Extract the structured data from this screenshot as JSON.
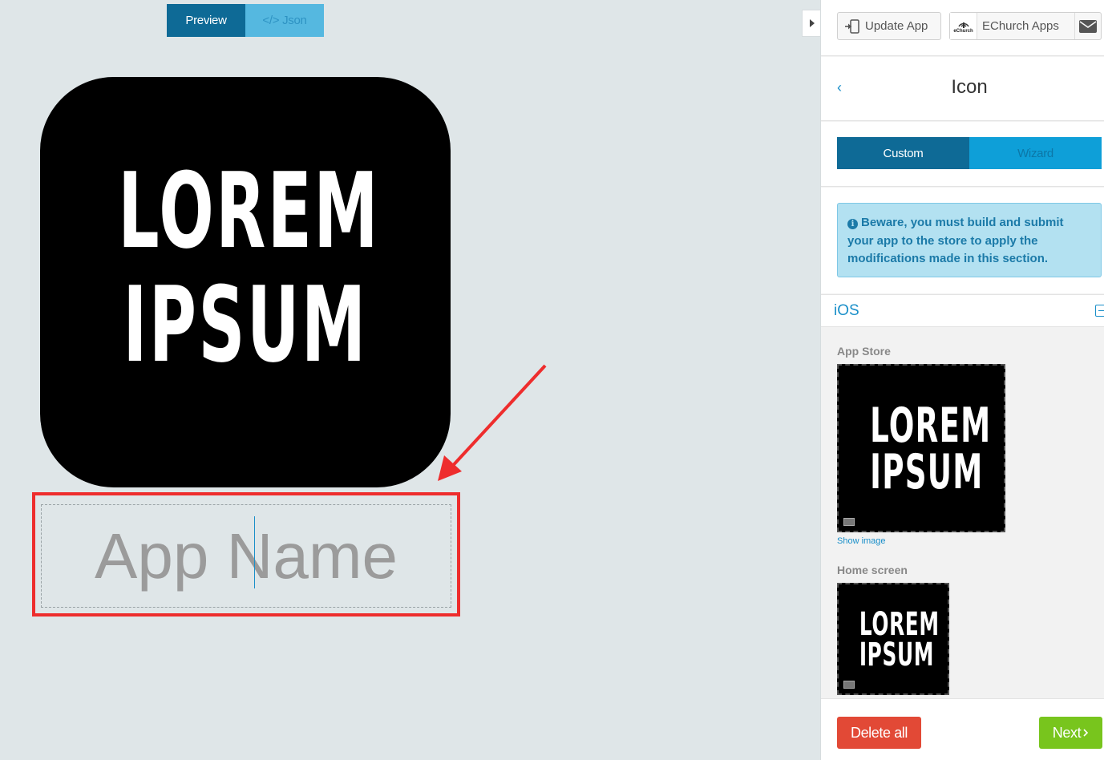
{
  "preview": {
    "tabs": [
      {
        "label": "Preview",
        "active": true
      },
      {
        "label": "</> Json",
        "active": false
      }
    ],
    "icon_text": {
      "line1": "LOREM",
      "line2": "IPSUM"
    },
    "app_name_placeholder": "App Name"
  },
  "panel": {
    "toolbar": {
      "update_label": "Update App",
      "app_logo_text": "eChurch",
      "app_name": "EChurch Apps"
    },
    "back_label": "‹",
    "title": "Icon",
    "mode_tabs": [
      {
        "label": "Custom",
        "active": true
      },
      {
        "label": "Wizard",
        "active": false
      }
    ],
    "warning": "Beware, you must build and submit your app to the store to apply the modifications made in this section.",
    "platform": "iOS",
    "app_store": {
      "label": "App Store",
      "show_image": "Show image"
    },
    "home_screen": {
      "label": "Home screen"
    },
    "footer": {
      "delete_label": "Delete all",
      "next_label": "Next"
    }
  },
  "colors": {
    "primary": "#0e6a96",
    "accent": "#1a8fc9",
    "highlight_border": "#ee2d2d",
    "delete": "#e24936",
    "next": "#78c51d"
  }
}
